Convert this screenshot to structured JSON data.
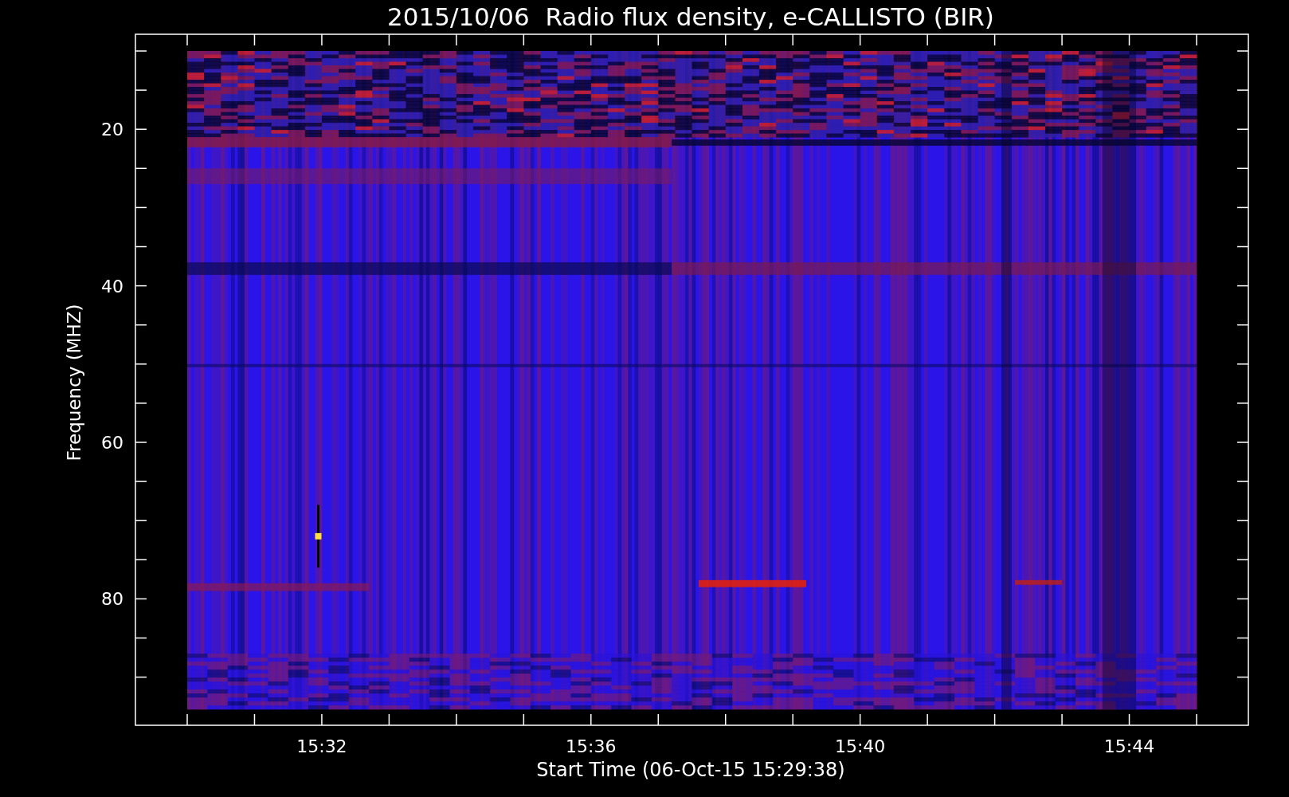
{
  "plot": {
    "title": "2015/10/06  Radio flux density, e-CALLISTO (BIR)",
    "xlabel": "Start Time (06-Oct-15 15:29:38)",
    "ylabel": "Frequency (MHZ)",
    "x_tick_labels": [
      "15:32",
      "15:36",
      "15:40",
      "15:44"
    ],
    "y_tick_labels": [
      "20",
      "40",
      "60",
      "80"
    ]
  }
}
